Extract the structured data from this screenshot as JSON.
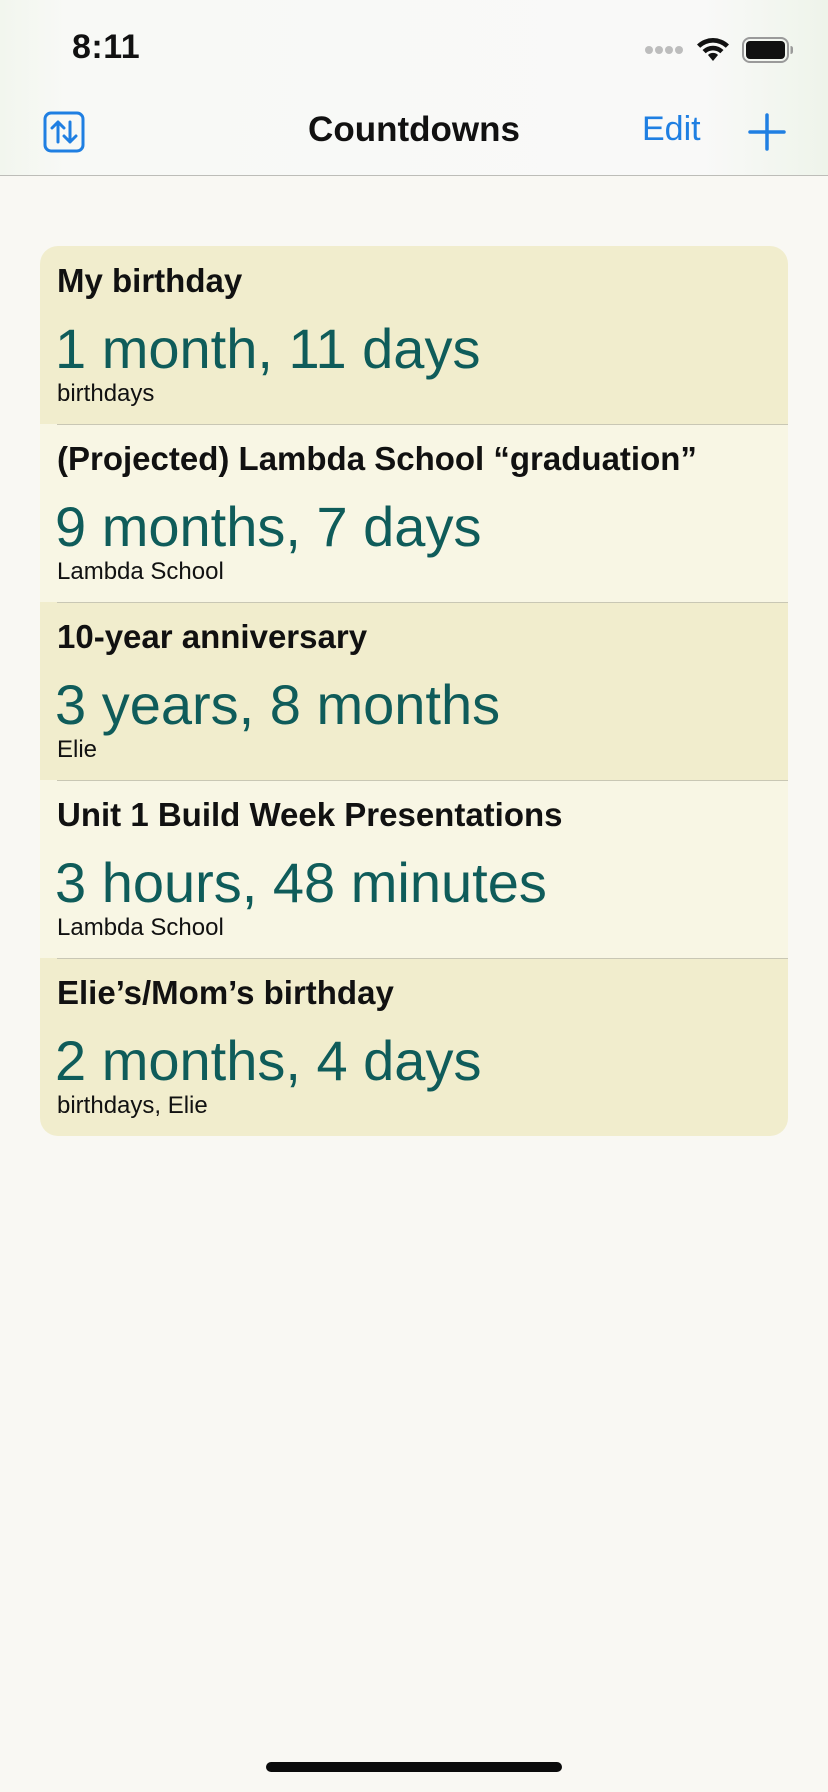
{
  "status_bar": {
    "time": "8:11"
  },
  "nav": {
    "title": "Countdowns",
    "edit_label": "Edit",
    "left_icon": "sort-arrows-icon",
    "right_icon": "plus-icon"
  },
  "countdowns": [
    {
      "title": "My birthday",
      "countdown": "1 month, 11 days",
      "tags": "birthdays"
    },
    {
      "title": "(Projected) Lambda School “graduation”",
      "countdown": "9 months, 7 days",
      "tags": "Lambda School"
    },
    {
      "title": "10-year anniversary",
      "countdown": "3 years, 8 months",
      "tags": "Elie"
    },
    {
      "title": "Unit 1 Build Week Presentations",
      "countdown": "3 hours, 48 minutes",
      "tags": "Lambda School"
    },
    {
      "title": "Elie’s/Mom’s birthday",
      "countdown": "2 months, 4 days",
      "tags": "birthdays, Elie"
    }
  ],
  "colors": {
    "accent": "#1f7fe2",
    "countdown_text": "#0f5c5a",
    "row_odd": "#f1edcd",
    "row_even": "#f8f6e4",
    "background": "#f9f8f3"
  }
}
